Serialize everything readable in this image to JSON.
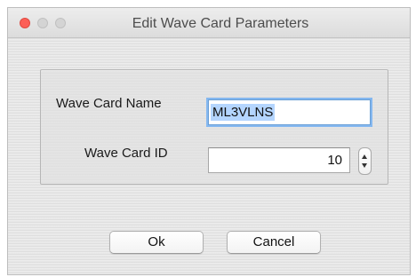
{
  "window": {
    "title": "Edit Wave Card Parameters"
  },
  "form": {
    "name_label": "Wave Card Name",
    "name_value": "ML3VLNS",
    "id_label": "Wave Card ID",
    "id_value": "10"
  },
  "buttons": {
    "ok_label": "Ok",
    "cancel_label": "Cancel"
  },
  "icons": {
    "close": "close-icon",
    "minimize": "minimize-icon",
    "zoom": "zoom-icon",
    "stepper": "stepper-icon"
  },
  "colors": {
    "close_button": "#fc5f57",
    "focus_ring": "#85b8f0",
    "selection": "#b4d5fe"
  }
}
